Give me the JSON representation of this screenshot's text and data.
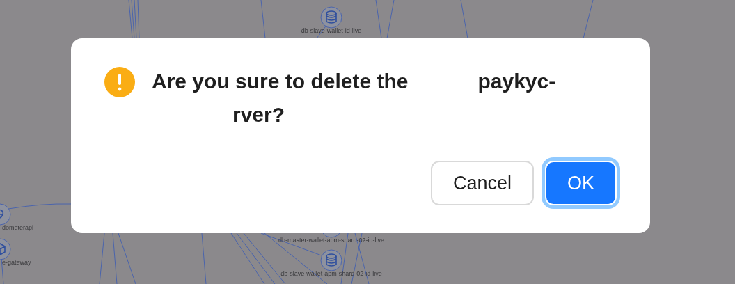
{
  "graph": {
    "nodes": [
      {
        "label": "db-slave-wallet-id-live",
        "kind": "database"
      },
      {
        "label": "dometerapi",
        "kind": "service"
      },
      {
        "label": "e-gateway",
        "kind": "gateway"
      },
      {
        "label": "db-master-wallet-apm-shard-02-id-live",
        "kind": "database"
      },
      {
        "label": "db-slave-wallet-apm-shard-02-id-live",
        "kind": "database"
      }
    ]
  },
  "dialog": {
    "kind": "warning",
    "message": "Are you sure to delete the",
    "visible_tail": "paykyc-",
    "second_line_tail": "rver?",
    "buttons": [
      {
        "label": "Cancel",
        "kind": "default",
        "focused": false
      },
      {
        "label": "OK",
        "kind": "primary",
        "focused": true
      }
    ]
  }
}
